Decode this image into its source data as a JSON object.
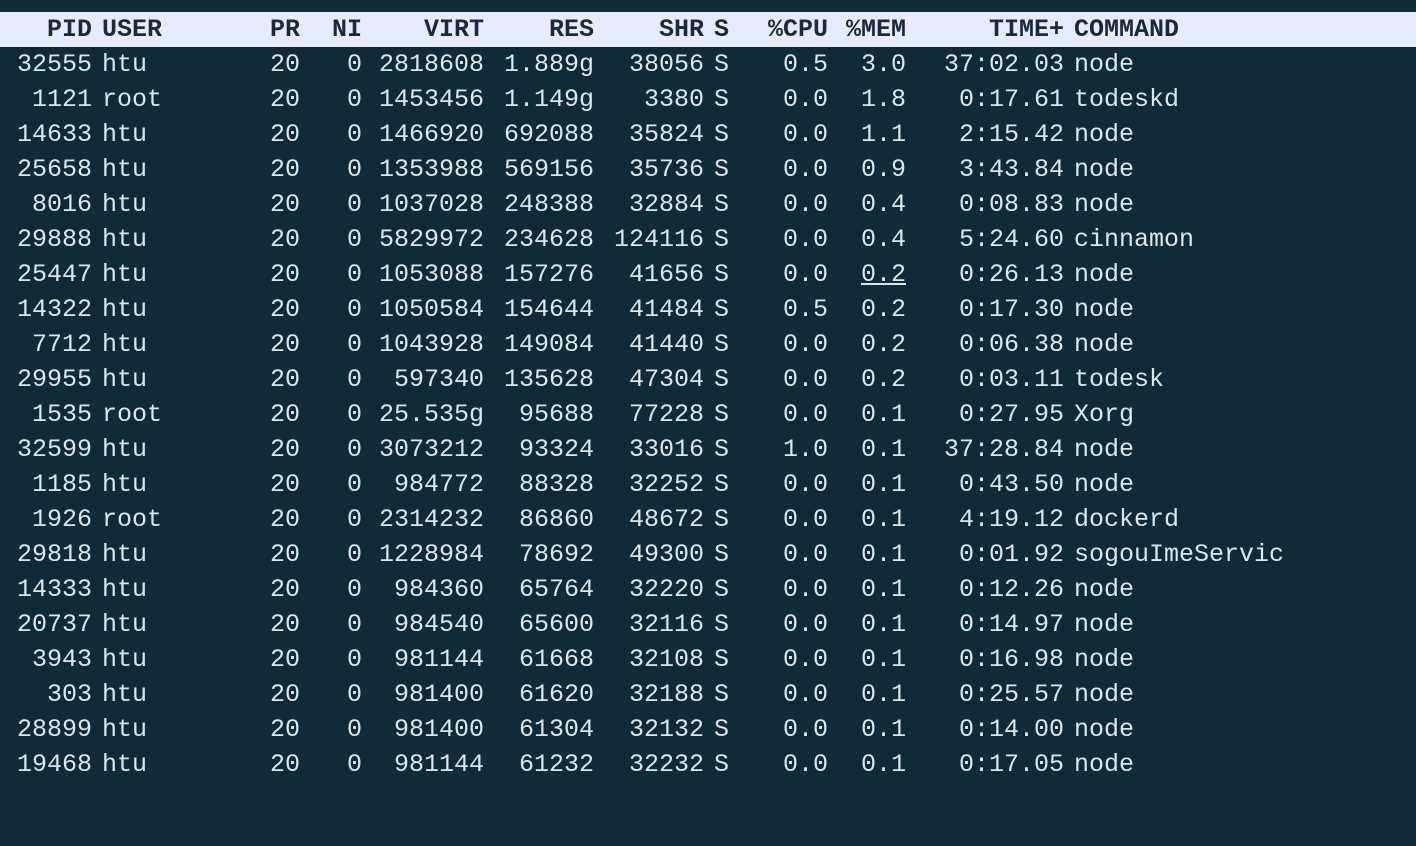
{
  "headers": {
    "pid": "PID",
    "user": "USER",
    "pr": "PR",
    "ni": "NI",
    "virt": "VIRT",
    "res": "RES",
    "shr": "SHR",
    "s": "S",
    "cpu": "%CPU",
    "mem": "%MEM",
    "time": "TIME+",
    "command": "COMMAND"
  },
  "rows": [
    {
      "pid": "32555",
      "user": "htu",
      "pr": "20",
      "ni": "0",
      "virt": "2818608",
      "res": "1.889g",
      "shr": "38056",
      "s": "S",
      "cpu": "0.5",
      "mem": "3.0",
      "time": "37:02.03",
      "command": "node"
    },
    {
      "pid": "1121",
      "user": "root",
      "pr": "20",
      "ni": "0",
      "virt": "1453456",
      "res": "1.149g",
      "shr": "3380",
      "s": "S",
      "cpu": "0.0",
      "mem": "1.8",
      "time": "0:17.61",
      "command": "todeskd"
    },
    {
      "pid": "14633",
      "user": "htu",
      "pr": "20",
      "ni": "0",
      "virt": "1466920",
      "res": "692088",
      "shr": "35824",
      "s": "S",
      "cpu": "0.0",
      "mem": "1.1",
      "time": "2:15.42",
      "command": "node"
    },
    {
      "pid": "25658",
      "user": "htu",
      "pr": "20",
      "ni": "0",
      "virt": "1353988",
      "res": "569156",
      "shr": "35736",
      "s": "S",
      "cpu": "0.0",
      "mem": "0.9",
      "time": "3:43.84",
      "command": "node"
    },
    {
      "pid": "8016",
      "user": "htu",
      "pr": "20",
      "ni": "0",
      "virt": "1037028",
      "res": "248388",
      "shr": "32884",
      "s": "S",
      "cpu": "0.0",
      "mem": "0.4",
      "time": "0:08.83",
      "command": "node"
    },
    {
      "pid": "29888",
      "user": "htu",
      "pr": "20",
      "ni": "0",
      "virt": "5829972",
      "res": "234628",
      "shr": "124116",
      "s": "S",
      "cpu": "0.0",
      "mem": "0.4",
      "time": "5:24.60",
      "command": "cinnamon"
    },
    {
      "pid": "25447",
      "user": "htu",
      "pr": "20",
      "ni": "0",
      "virt": "1053088",
      "res": "157276",
      "shr": "41656",
      "s": "S",
      "cpu": "0.0",
      "mem": "0.2",
      "time": "0:26.13",
      "command": "node",
      "mem_underline": true
    },
    {
      "pid": "14322",
      "user": "htu",
      "pr": "20",
      "ni": "0",
      "virt": "1050584",
      "res": "154644",
      "shr": "41484",
      "s": "S",
      "cpu": "0.5",
      "mem": "0.2",
      "time": "0:17.30",
      "command": "node"
    },
    {
      "pid": "7712",
      "user": "htu",
      "pr": "20",
      "ni": "0",
      "virt": "1043928",
      "res": "149084",
      "shr": "41440",
      "s": "S",
      "cpu": "0.0",
      "mem": "0.2",
      "time": "0:06.38",
      "command": "node"
    },
    {
      "pid": "29955",
      "user": "htu",
      "pr": "20",
      "ni": "0",
      "virt": "597340",
      "res": "135628",
      "shr": "47304",
      "s": "S",
      "cpu": "0.0",
      "mem": "0.2",
      "time": "0:03.11",
      "command": "todesk"
    },
    {
      "pid": "1535",
      "user": "root",
      "pr": "20",
      "ni": "0",
      "virt": "25.535g",
      "res": "95688",
      "shr": "77228",
      "s": "S",
      "cpu": "0.0",
      "mem": "0.1",
      "time": "0:27.95",
      "command": "Xorg"
    },
    {
      "pid": "32599",
      "user": "htu",
      "pr": "20",
      "ni": "0",
      "virt": "3073212",
      "res": "93324",
      "shr": "33016",
      "s": "S",
      "cpu": "1.0",
      "mem": "0.1",
      "time": "37:28.84",
      "command": "node"
    },
    {
      "pid": "1185",
      "user": "htu",
      "pr": "20",
      "ni": "0",
      "virt": "984772",
      "res": "88328",
      "shr": "32252",
      "s": "S",
      "cpu": "0.0",
      "mem": "0.1",
      "time": "0:43.50",
      "command": "node"
    },
    {
      "pid": "1926",
      "user": "root",
      "pr": "20",
      "ni": "0",
      "virt": "2314232",
      "res": "86860",
      "shr": "48672",
      "s": "S",
      "cpu": "0.0",
      "mem": "0.1",
      "time": "4:19.12",
      "command": "dockerd"
    },
    {
      "pid": "29818",
      "user": "htu",
      "pr": "20",
      "ni": "0",
      "virt": "1228984",
      "res": "78692",
      "shr": "49300",
      "s": "S",
      "cpu": "0.0",
      "mem": "0.1",
      "time": "0:01.92",
      "command": "sogouImeServic"
    },
    {
      "pid": "14333",
      "user": "htu",
      "pr": "20",
      "ni": "0",
      "virt": "984360",
      "res": "65764",
      "shr": "32220",
      "s": "S",
      "cpu": "0.0",
      "mem": "0.1",
      "time": "0:12.26",
      "command": "node"
    },
    {
      "pid": "20737",
      "user": "htu",
      "pr": "20",
      "ni": "0",
      "virt": "984540",
      "res": "65600",
      "shr": "32116",
      "s": "S",
      "cpu": "0.0",
      "mem": "0.1",
      "time": "0:14.97",
      "command": "node"
    },
    {
      "pid": "3943",
      "user": "htu",
      "pr": "20",
      "ni": "0",
      "virt": "981144",
      "res": "61668",
      "shr": "32108",
      "s": "S",
      "cpu": "0.0",
      "mem": "0.1",
      "time": "0:16.98",
      "command": "node"
    },
    {
      "pid": "303",
      "user": "htu",
      "pr": "20",
      "ni": "0",
      "virt": "981400",
      "res": "61620",
      "shr": "32188",
      "s": "S",
      "cpu": "0.0",
      "mem": "0.1",
      "time": "0:25.57",
      "command": "node"
    },
    {
      "pid": "28899",
      "user": "htu",
      "pr": "20",
      "ni": "0",
      "virt": "981400",
      "res": "61304",
      "shr": "32132",
      "s": "S",
      "cpu": "0.0",
      "mem": "0.1",
      "time": "0:14.00",
      "command": "node"
    },
    {
      "pid": "19468",
      "user": "htu",
      "pr": "20",
      "ni": "0",
      "virt": "981144",
      "res": "61232",
      "shr": "32232",
      "s": "S",
      "cpu": "0.0",
      "mem": "0.1",
      "time": "0:17.05",
      "command": "node"
    }
  ]
}
